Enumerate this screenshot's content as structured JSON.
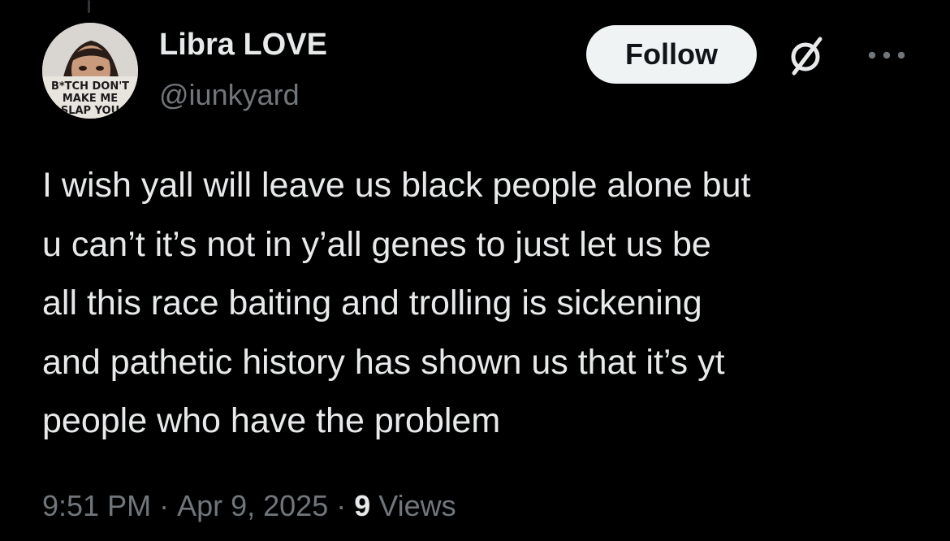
{
  "author": {
    "display_name": "Libra LOVE",
    "handle": "@iunkyard",
    "avatar_sticker_text": [
      "B*TCH DON'T",
      "MAKE ME",
      "SLAP YOU"
    ]
  },
  "actions": {
    "follow_label": "Follow",
    "grok_icon": "grok-slash-icon",
    "more_icon": "more-horizontal-icon"
  },
  "tweet": {
    "lines": [
      "I wish yall will leave us black people alone but",
      "u can’t it’s not in y’all genes to just let us be",
      "all this race baiting and trolling is sickening",
      "and pathetic history has shown us that it’s yt",
      "people who have the problem"
    ]
  },
  "meta": {
    "time": "9:51 PM",
    "date": "Apr 9, 2025",
    "separator": "·",
    "views_count": "9",
    "views_label": "Views"
  },
  "colors": {
    "background": "#000000",
    "primary_text": "#e7e9ea",
    "secondary_text": "#71767b",
    "follow_bg": "#eff3f4",
    "follow_text": "#0f1419"
  }
}
